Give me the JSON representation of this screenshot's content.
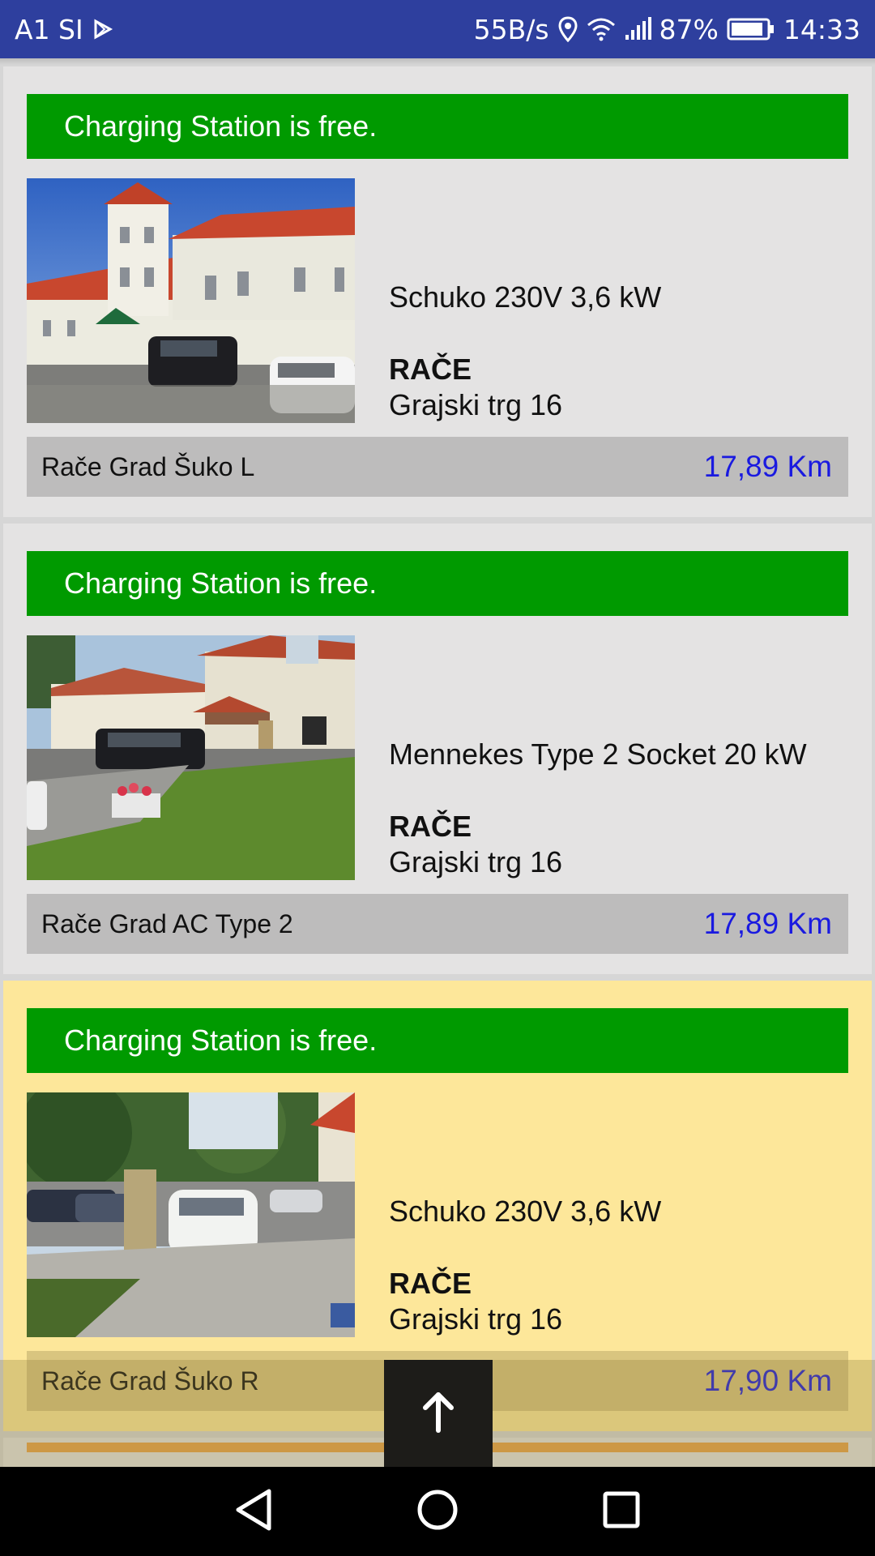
{
  "status_bar": {
    "carrier": "A1 SI",
    "net_speed": "55B/s",
    "battery_percent": "87%",
    "time": "14:33",
    "icons": [
      "play-store-icon",
      "location-icon",
      "wifi-icon",
      "signal-icon",
      "battery-icon"
    ]
  },
  "stations": [
    {
      "status": "Charging Station is free.",
      "connector": "Schuko 230V 3,6 kW",
      "city": "RAČE",
      "street": "Grajski trg 16",
      "name": "Rače Grad Šuko L",
      "distance": "17,89 Km",
      "highlighted": false
    },
    {
      "status": "Charging Station is free.",
      "connector": "Mennekes Type 2 Socket 20 kW",
      "city": "RAČE",
      "street": "Grajski trg 16",
      "name": "Rače Grad AC Type 2",
      "distance": "17,89 Km",
      "highlighted": false
    },
    {
      "status": "Charging Station is free.",
      "connector": "Schuko 230V 3,6 kW",
      "city": "RAČE",
      "street": "Grajski trg 16",
      "name": "Rače Grad Šuko R",
      "distance": "17,90 Km",
      "highlighted": true
    }
  ],
  "colors": {
    "status_bar": "#2e3f9e",
    "free_banner": "#009a00",
    "distance_text": "#1a1ae0",
    "highlight_card": "#fde79a"
  },
  "scroll_top_icon": "arrow-up-icon",
  "nav_bar_icons": [
    "back-icon",
    "home-icon",
    "recents-icon"
  ]
}
